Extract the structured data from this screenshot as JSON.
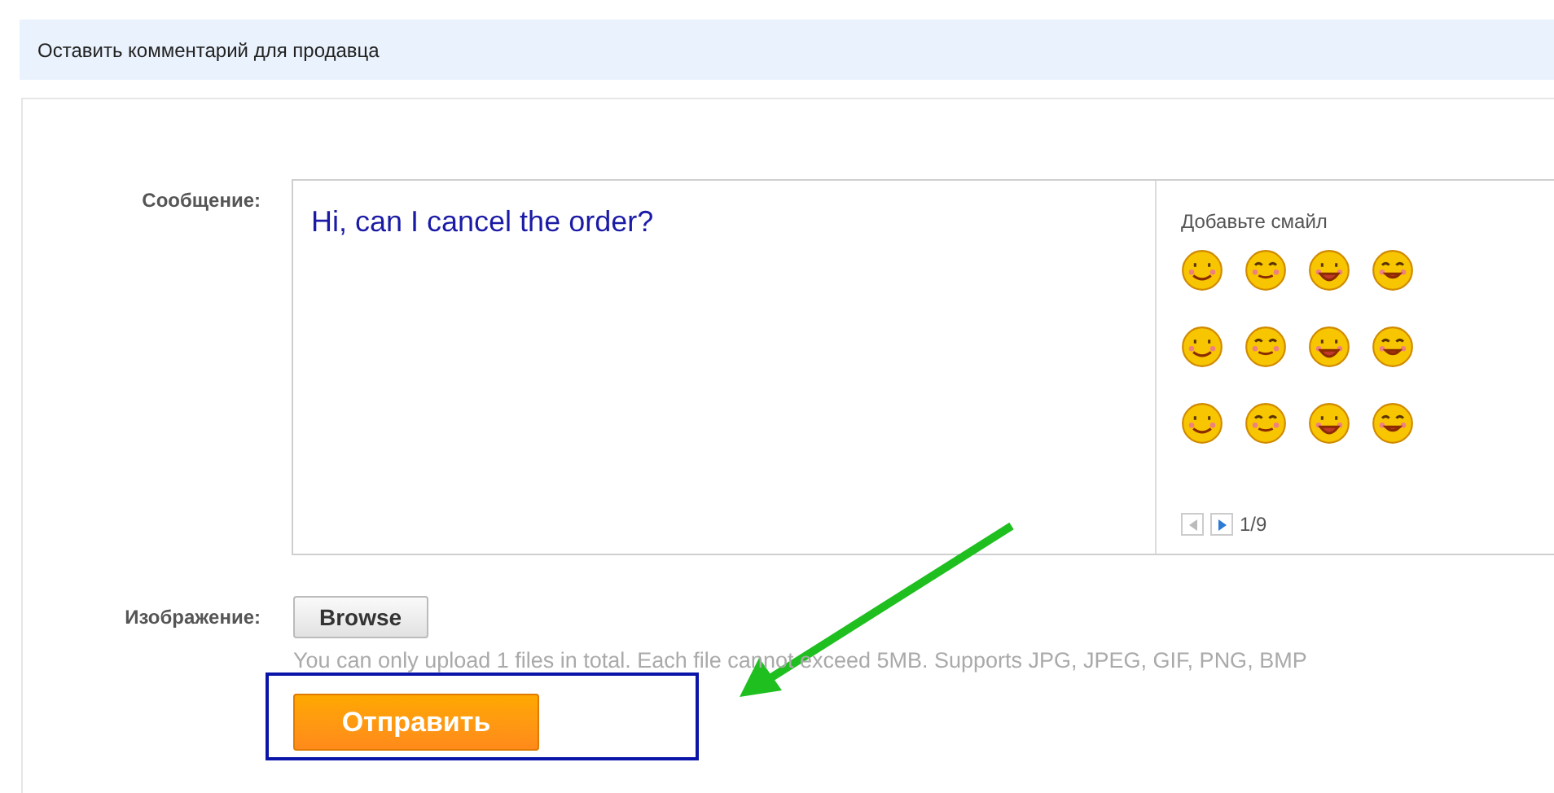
{
  "header": {
    "title": "Оставить комментарий для продавца"
  },
  "message": {
    "label": "Сообщение:",
    "value": "Hi, can I cancel the order?"
  },
  "smileys": {
    "title": "Добавьте смайл",
    "page": "1/9"
  },
  "image": {
    "label": "Изображение:",
    "browse_button": "Browse",
    "hint": "You can only upload 1 files in total. Each file cannot exceed 5MB. Supports JPG, JPEG, GIF, PNG, BMP"
  },
  "submit_button": "Отправить"
}
